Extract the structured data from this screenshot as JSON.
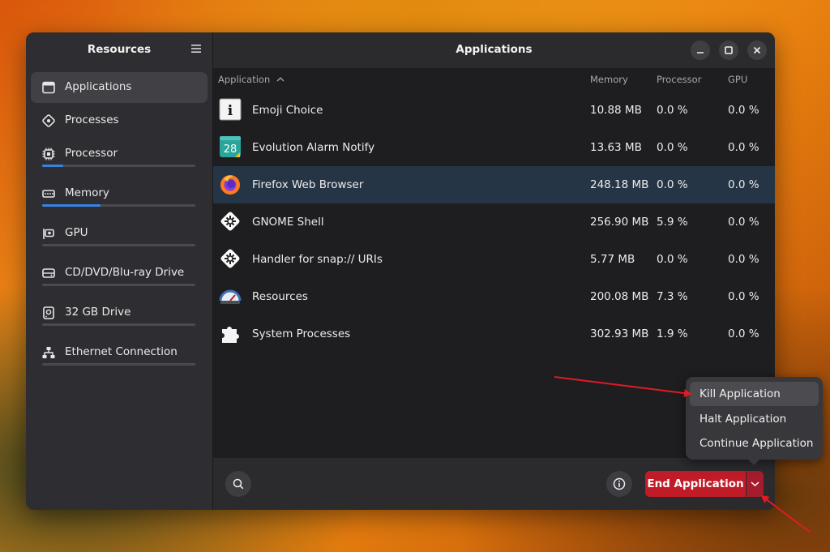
{
  "sidebar": {
    "title": "Resources",
    "items": [
      {
        "label": "Applications",
        "icon": "window-icon",
        "active": true
      },
      {
        "label": "Processes",
        "icon": "processes-icon"
      },
      {
        "label": "Processor",
        "icon": "cpu-icon",
        "usage": 0.14
      },
      {
        "label": "Memory",
        "icon": "memory-icon",
        "usage": 0.38
      },
      {
        "label": "GPU",
        "icon": "gpu-icon",
        "usage": 0.0
      },
      {
        "label": "CD/DVD/Blu-ray Drive",
        "icon": "optical-drive-icon",
        "usage": 0.0
      },
      {
        "label": "32 GB Drive",
        "icon": "drive-icon",
        "usage": 0.0
      },
      {
        "label": "Ethernet Connection",
        "icon": "network-icon",
        "usage": 0.0
      }
    ]
  },
  "main": {
    "title": "Applications",
    "columns": {
      "application": "Application",
      "memory": "Memory",
      "processor": "Processor",
      "gpu": "GPU"
    },
    "rows": [
      {
        "name": "Emoji Choice",
        "memory": "10.88 MB",
        "processor": "0.0 %",
        "gpu": "0.0 %",
        "icon": "info-app-icon"
      },
      {
        "name": "Evolution Alarm Notify",
        "memory": "13.63 MB",
        "processor": "0.0 %",
        "gpu": "0.0 %",
        "icon": "calendar-icon",
        "icon_text": "28"
      },
      {
        "name": "Firefox Web Browser",
        "memory": "248.18 MB",
        "processor": "0.0 %",
        "gpu": "0.0 %",
        "icon": "firefox-icon",
        "selected": true
      },
      {
        "name": "GNOME Shell",
        "memory": "256.90 MB",
        "processor": "5.9 %",
        "gpu": "0.0 %",
        "icon": "gnome-shell-icon"
      },
      {
        "name": "Handler for snap:// URIs",
        "memory": "5.77 MB",
        "processor": "0.0 %",
        "gpu": "0.0 %",
        "icon": "snap-handler-icon"
      },
      {
        "name": "Resources",
        "memory": "200.08 MB",
        "processor": "7.3 %",
        "gpu": "0.0 %",
        "icon": "gauge-icon"
      },
      {
        "name": "System Processes",
        "memory": "302.93 MB",
        "processor": "1.9 %",
        "gpu": "0.0 %",
        "icon": "puzzle-icon"
      }
    ]
  },
  "toolbar": {
    "end_label": "End Application"
  },
  "popover": {
    "items": [
      "Kill Application",
      "Halt Application",
      "Continue Application"
    ]
  },
  "colors": {
    "accent": "#3584e4",
    "destructive": "#c01c28",
    "selection": "#263546",
    "annotation": "#e01b24"
  }
}
